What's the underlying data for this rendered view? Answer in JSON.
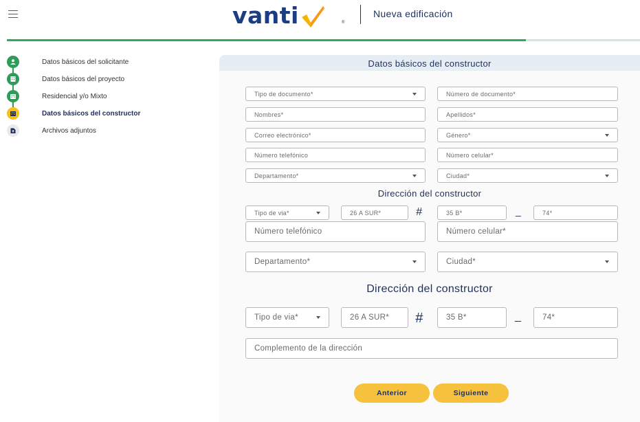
{
  "header": {
    "brand": "vanti",
    "registered": "®",
    "title": "Nueva edificación",
    "progress_fraction": 0.82
  },
  "colors": {
    "brand_blue": "#1d3d82",
    "success_green": "#2e9b59",
    "accent_yellow": "#f4c119",
    "button_yellow": "#f6c23e"
  },
  "sidebar": {
    "steps": [
      {
        "label": "Datos básicos del solicitante",
        "status": "done",
        "icon": "person-icon"
      },
      {
        "label": "Datos básicos del proyecto",
        "status": "done",
        "icon": "building-icon"
      },
      {
        "label": "Residencial y/o Mixto",
        "status": "done",
        "icon": "building-icon"
      },
      {
        "label": "Datos básicos del constructor",
        "status": "active",
        "icon": "building-icon"
      },
      {
        "label": "Archivos adjuntos",
        "status": "pending",
        "icon": "file-upload-icon"
      }
    ]
  },
  "form": {
    "title": "Datos básicos del constructor",
    "small": {
      "tipo_documento": "Tipo de documento*",
      "numero_documento": "Número de documento*",
      "nombres": "Nombres*",
      "apellidos": "Apellidos*",
      "correo": "Correo electrónico*",
      "genero": "Género*",
      "telefono": "Número telefónico",
      "celular": "Número celular*",
      "departamento": "Departamento*",
      "ciudad": "Ciudad*",
      "address_title": "Dirección del constructor",
      "tipo_via": "Tipo de via*",
      "via_num": "26 A SUR*",
      "hash": "#",
      "cruce": "35 B*",
      "dash": "_",
      "placa": "74*"
    },
    "large": {
      "telefono": "Número telefónico",
      "celular": "Número celular*",
      "departamento": "Departamento*",
      "ciudad": "Ciudad*",
      "address_title": "Dirección del constructor",
      "tipo_via": "Tipo de via*",
      "via_num": "26 A SUR*",
      "hash": "#",
      "cruce": "35 B*",
      "dash": "_",
      "placa": "74*",
      "complemento": "Complemento de la dirección"
    }
  },
  "buttons": {
    "anterior": "Anterior",
    "siguiente": "Siguiente"
  }
}
